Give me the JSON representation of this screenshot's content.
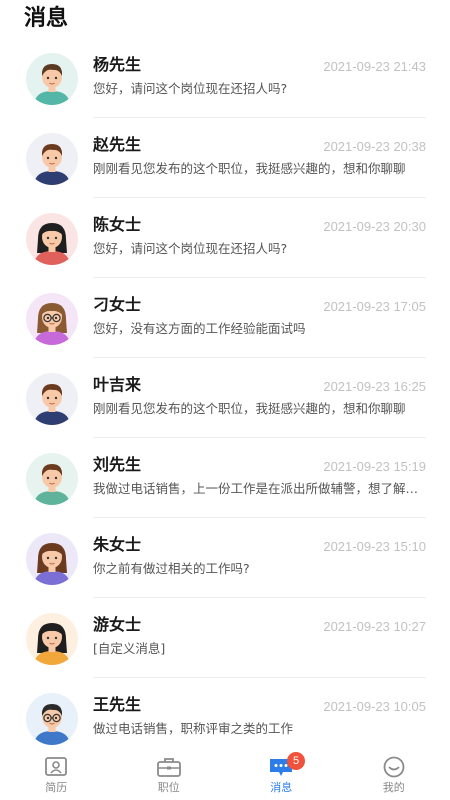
{
  "header": {
    "title": "消息"
  },
  "messages": [
    {
      "name": "杨先生",
      "time": "2021-09-23 21:43",
      "preview": "您好，请问这个岗位现在还招人吗?",
      "avatar": "avatar-man-teal"
    },
    {
      "name": "赵先生",
      "time": "2021-09-23 20:38",
      "preview": "刚刚看见您发布的这个职位，我挺感兴趣的，想和你聊聊",
      "avatar": "avatar-man-navy"
    },
    {
      "name": "陈女士",
      "time": "2021-09-23 20:30",
      "preview": "您好，请问这个岗位现在还招人吗?",
      "avatar": "avatar-woman-red"
    },
    {
      "name": "刁女士",
      "time": "2021-09-23 17:05",
      "preview": "您好，没有这方面的工作经验能面试吗",
      "avatar": "avatar-woman-glasses"
    },
    {
      "name": "叶吉来",
      "time": "2021-09-23 16:25",
      "preview": "刚刚看见您发布的这个职位，我挺感兴趣的，想和你聊聊",
      "avatar": "avatar-man-navy"
    },
    {
      "name": "刘先生",
      "time": "2021-09-23 15:19",
      "preview": "我做过电话销售，上一份工作是在派出所做辅警，想了解一下",
      "avatar": "avatar-man-green"
    },
    {
      "name": "朱女士",
      "time": "2021-09-23 15:10",
      "preview": "你之前有做过相关的工作吗?",
      "avatar": "avatar-woman-purple"
    },
    {
      "name": "游女士",
      "time": "2021-09-23 10:27",
      "preview": "[自定义消息]",
      "avatar": "avatar-woman-orange"
    },
    {
      "name": "王先生",
      "time": "2021-09-23 10:05",
      "preview": "做过电话销售，职称评审之类的工作",
      "avatar": "avatar-man-glasses"
    }
  ],
  "tabs": [
    {
      "label": "简历",
      "icon": "resume-icon",
      "active": false
    },
    {
      "label": "职位",
      "icon": "briefcase-icon",
      "active": false
    },
    {
      "label": "消息",
      "icon": "message-icon",
      "active": true,
      "badge": "5"
    },
    {
      "label": "我的",
      "icon": "profile-icon",
      "active": false
    }
  ],
  "colors": {
    "accent": "#2b7de9",
    "badge": "#f0523c",
    "time": "#c2c2c2"
  }
}
